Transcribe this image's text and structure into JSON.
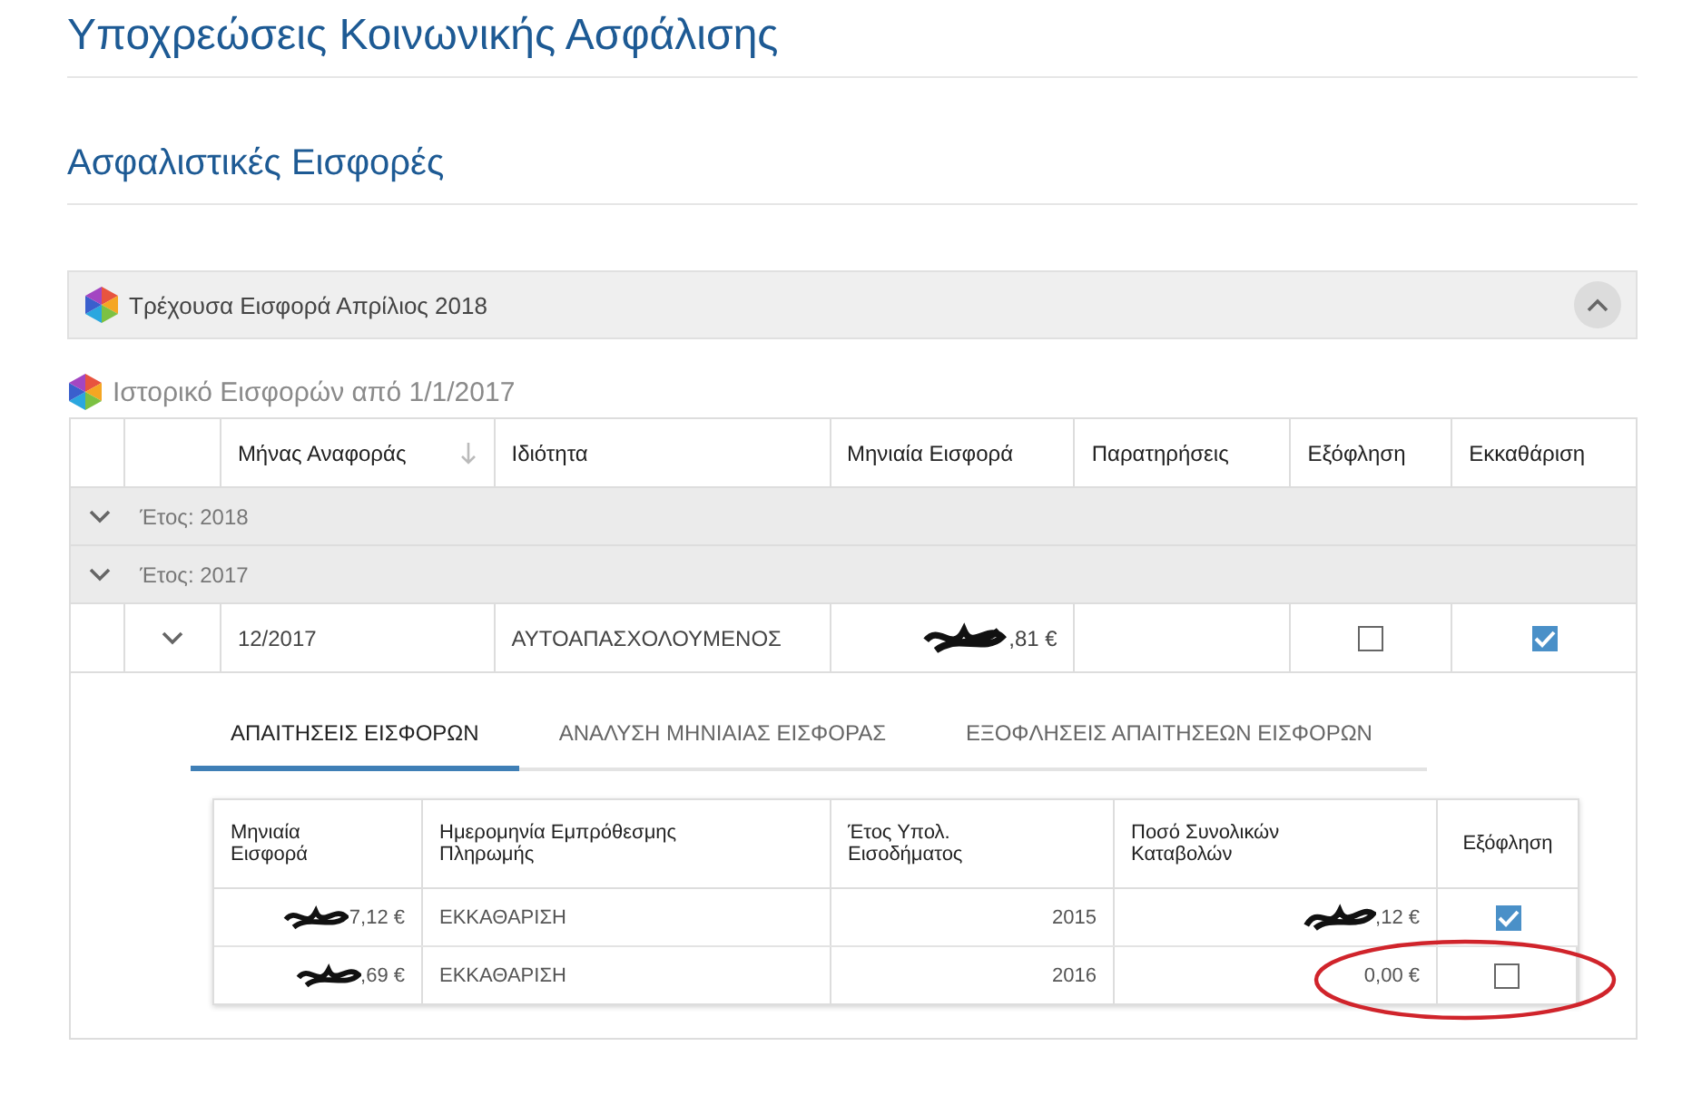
{
  "page_title": "Υποχρεώσεις Κοινωνικής Ασφάλισης",
  "section_title": "Ασφαλιστικές Εισφορές",
  "current_panel": {
    "title": "Τρέχουσα Εισφορά Απρίλιος 2018"
  },
  "history": {
    "title": "Ιστορικό Εισφορών από 1/1/2017",
    "columns": [
      {
        "label": "Μήνας Αναφοράς",
        "sorted": true
      },
      {
        "label": "Ιδιότητα",
        "sorted": false
      },
      {
        "label": "Μηνιαία Εισφορά",
        "sorted": false
      },
      {
        "label": "Παρατηρήσεις",
        "sorted": false
      },
      {
        "label": "Εξόφληση",
        "sorted": false
      },
      {
        "label": "Εκκαθάριση",
        "sorted": false
      }
    ],
    "groups": [
      {
        "label": "Έτος: 2018"
      },
      {
        "label": "Έτος: 2017",
        "rows": [
          {
            "month": "12/2017",
            "capacity": "ΑΥΤΟΑΠΑΣΧΟΛΟΥΜΕΝΟΣ",
            "amount": ",81 €",
            "amount_redacted": true,
            "paid": false,
            "cleared": true,
            "details": {
              "tabs": [
                {
                  "label": "ΑΠΑΙΤΗΣΕΙΣ ΕΙΣΦΟΡΩΝ",
                  "selected": true
                },
                {
                  "label": "ΑΝΑΛΥΣΗ ΜΗΝΙΑΙΑΣ ΕΙΣΦΟΡΑΣ",
                  "selected": false
                },
                {
                  "label": "ΕΞΟΦΛΗΣΕΙΣ ΑΠΑΙΤΗΣΕΩΝ ΕΙΣΦΟΡΩΝ",
                  "selected": false
                }
              ],
              "columns": [
                "Μηνιαία Εισφορά",
                "Ημερομηνία Εμπρόθεσμης Πληρωμής",
                "Έτος Υπολ. Εισοδήματος",
                "Ποσό Συνολικών Καταβολών",
                "Εξόφληση"
              ],
              "rows": [
                {
                  "amount": "7,12 €",
                  "amount_redacted": true,
                  "type": "ΕΚΚΑΘΑΡΙΣΗ",
                  "year": "2015",
                  "total": ",12 €",
                  "total_redacted": true,
                  "paid": true,
                  "circled": false
                },
                {
                  "amount": ",69 €",
                  "amount_redacted": true,
                  "type": "ΕΚΚΑΘΑΡΙΣΗ",
                  "year": "2016",
                  "total": "0,00 €",
                  "total_redacted": false,
                  "paid": false,
                  "circled": true
                }
              ]
            }
          }
        ]
      }
    ]
  }
}
